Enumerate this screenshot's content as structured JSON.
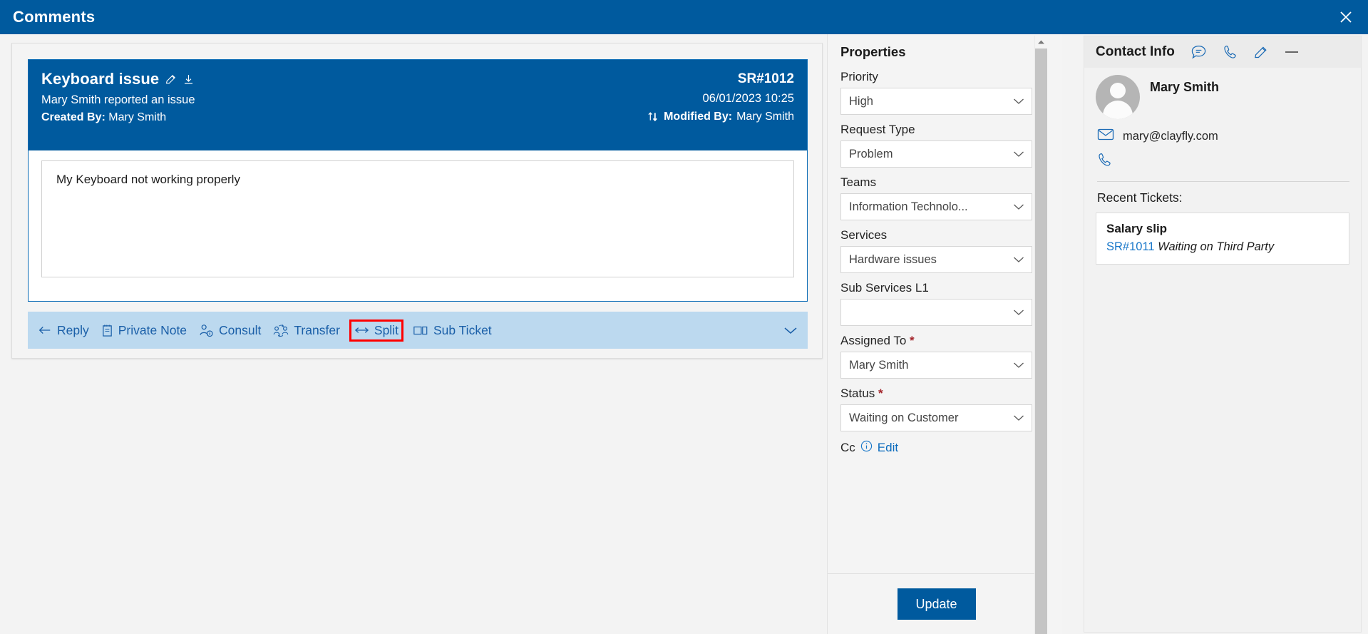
{
  "window": {
    "title": "Comments",
    "close_icon": "close-icon",
    "accent_color": "#005a9e"
  },
  "ticket": {
    "title": "Keyboard issue",
    "edit_icon": "pencil-icon",
    "download_icon": "download-icon",
    "subtitle": "Mary Smith reported an issue",
    "created_by_label": "Created By:",
    "created_by_value": "Mary Smith",
    "id": "SR#1012",
    "datetime": "06/01/2023 10:25",
    "sort_icon": "sort-updown-icon",
    "modified_by_label": "Modified By:",
    "modified_by_value": "Mary Smith",
    "message": "My Keyboard not working properly"
  },
  "actions": {
    "items": [
      {
        "label": "Reply",
        "icon": "reply-arrow-icon",
        "highlighted": false
      },
      {
        "label": "Private Note",
        "icon": "note-icon",
        "highlighted": false
      },
      {
        "label": "Consult",
        "icon": "person-info-icon",
        "highlighted": false
      },
      {
        "label": "Transfer",
        "icon": "transfer-people-icon",
        "highlighted": false
      },
      {
        "label": "Split",
        "icon": "split-arrows-icon",
        "highlighted": true
      },
      {
        "label": "Sub Ticket",
        "icon": "sub-ticket-icon",
        "highlighted": false
      }
    ],
    "expand_icon": "chevron-down-icon",
    "highlight_color": "#ff0000",
    "bar_color": "#bcd9ef",
    "text_color": "#1a5fa8"
  },
  "properties": {
    "heading": "Properties",
    "fields": [
      {
        "label": "Priority",
        "value": "High",
        "required": false
      },
      {
        "label": "Request Type",
        "value": "Problem",
        "required": false
      },
      {
        "label": "Teams",
        "value": "Information Technolo...",
        "required": false
      },
      {
        "label": "Services",
        "value": "Hardware issues",
        "required": false
      },
      {
        "label": "Sub Services L1",
        "value": "",
        "required": false
      },
      {
        "label": "Assigned To",
        "value": "Mary Smith",
        "required": true
      },
      {
        "label": "Status",
        "value": "Waiting on Customer",
        "required": true
      }
    ],
    "required_marker": "*",
    "cc_label": "Cc",
    "cc_info_icon": "info-circle-icon",
    "cc_edit_label": "Edit",
    "update_button": "Update",
    "chevron_icon": "chevron-down-icon",
    "scrollbar_up_icon": "scroll-up-arrow-icon"
  },
  "contact": {
    "heading": "Contact Info",
    "header_icons": [
      {
        "name": "chat-icon"
      },
      {
        "name": "phone-icon"
      },
      {
        "name": "pencil-icon"
      },
      {
        "name": "minimize-icon"
      }
    ],
    "avatar_icon": "avatar-icon",
    "name": "Mary Smith",
    "email_icon": "envelope-icon",
    "email": "mary@clayfly.com",
    "phone_icon": "phone-icon",
    "phone": "",
    "recent_label": "Recent Tickets:",
    "recent_tickets": [
      {
        "title": "Salary slip",
        "id": "SR#1011",
        "status": "Waiting on Third Party"
      }
    ]
  }
}
